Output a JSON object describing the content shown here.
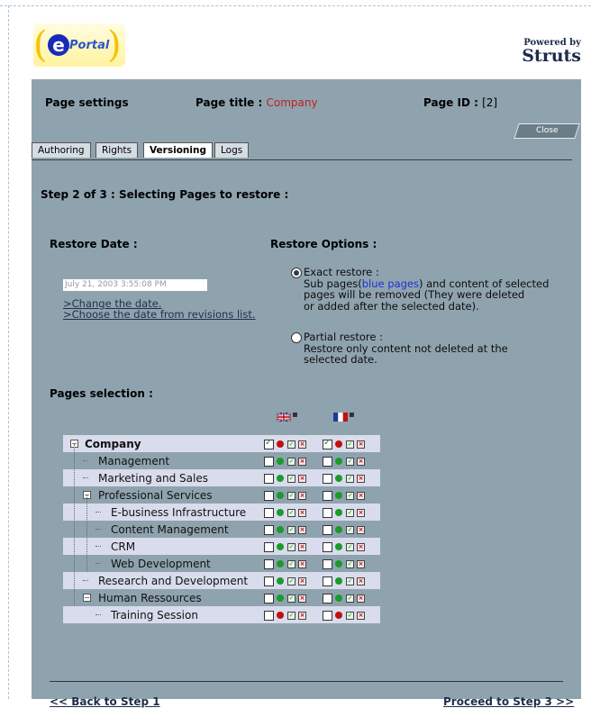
{
  "header": {
    "logo_text": "ePortal",
    "powered_by": "Powered by",
    "struts": "Struts"
  },
  "settings": {
    "page_settings": "Page settings",
    "page_title_label": "Page title : ",
    "page_title_value": "Company",
    "page_id_label": "Page ID : ",
    "page_id_value": "[2]"
  },
  "close_label": "Close",
  "tabs": [
    "Authoring",
    "Rights",
    "Versioning",
    "Logs"
  ],
  "active_tab": "Versioning",
  "step_title": "Step 2 of 3 : Selecting Pages to restore :",
  "restore_date": {
    "heading": "Restore Date :",
    "value": "July 21, 2003 3:55:08 PM",
    "change_link": ">Change the date.",
    "choose_link": ">Choose the date from revisions list."
  },
  "restore_options": {
    "heading": "Restore Options :",
    "exact": {
      "label": "Exact restore :",
      "desc_a": "Sub pages(",
      "desc_blue": "blue pages",
      "desc_b": ") and content of selected",
      "desc_line2": "pages will be removed (They were deleted",
      "desc_line3": "or added after the selected date).",
      "selected": true
    },
    "partial": {
      "label": "Partial restore :",
      "desc_line1": "Restore only content not deleted at the",
      "desc_line2": "selected date.",
      "selected": false
    }
  },
  "pages_selection": {
    "heading": "Pages selection :",
    "languages": [
      "en",
      "fr"
    ],
    "rows": [
      {
        "label": "Company",
        "checked_en": true,
        "checked_fr": true,
        "red_en": true,
        "red_fr": true
      },
      {
        "label": "Management",
        "checked_en": false,
        "checked_fr": false,
        "red_en": false,
        "red_fr": false
      },
      {
        "label": "Marketing and Sales",
        "checked_en": false,
        "checked_fr": false,
        "red_en": false,
        "red_fr": false
      },
      {
        "label": "Professional Services",
        "checked_en": false,
        "checked_fr": false,
        "red_en": false,
        "red_fr": false
      },
      {
        "label": "E-business Infrastructure",
        "checked_en": false,
        "checked_fr": false,
        "red_en": false,
        "red_fr": false
      },
      {
        "label": "Content Management",
        "checked_en": false,
        "checked_fr": false,
        "red_en": false,
        "red_fr": false
      },
      {
        "label": "CRM",
        "checked_en": false,
        "checked_fr": false,
        "red_en": false,
        "red_fr": false
      },
      {
        "label": "Web Development",
        "checked_en": false,
        "checked_fr": false,
        "red_en": false,
        "red_fr": false
      },
      {
        "label": "Research and Development",
        "checked_en": false,
        "checked_fr": false,
        "red_en": false,
        "red_fr": false
      },
      {
        "label": "Human Ressources",
        "checked_en": false,
        "checked_fr": false,
        "red_en": false,
        "red_fr": false
      },
      {
        "label": "Training Session",
        "checked_en": false,
        "checked_fr": false,
        "red_en": true,
        "red_fr": true
      }
    ]
  },
  "nav": {
    "back": "<< Back to Step 1",
    "proceed": "Proceed to Step 3 >>"
  }
}
